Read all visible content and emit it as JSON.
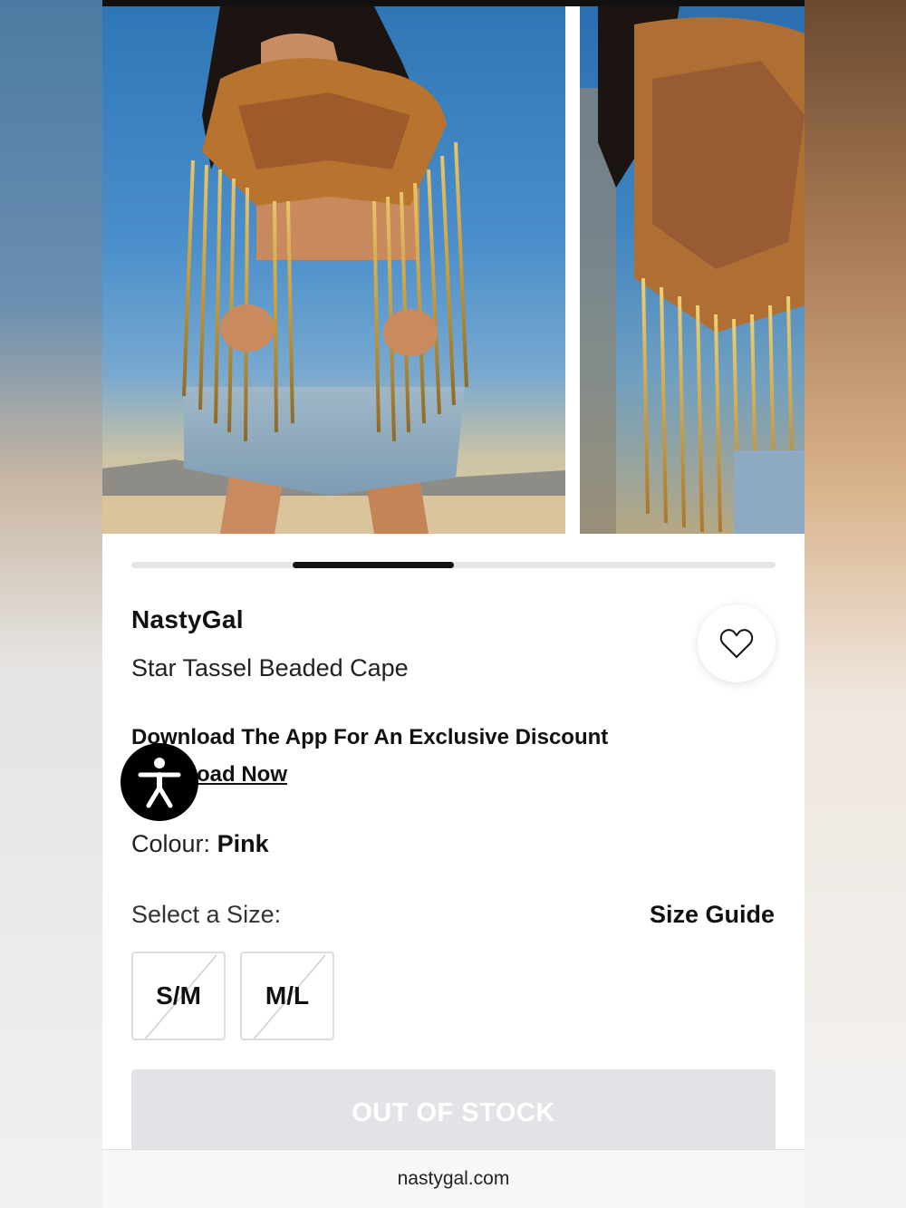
{
  "product": {
    "brand": "NastyGal",
    "name": "Star Tassel Beaded Cape",
    "colour_label": "Colour:",
    "colour_value": "Pink"
  },
  "promo": {
    "text": "Download The App For An Exclusive Discount",
    "link": "Download Now"
  },
  "sizes": {
    "label": "Select a Size:",
    "guide": "Size Guide",
    "options": [
      {
        "label": "S/M",
        "available": false
      },
      {
        "label": "M/L",
        "available": false
      }
    ]
  },
  "cta": {
    "label": "OUT OF STOCK"
  },
  "browser": {
    "url": "nastygal.com"
  },
  "gallery": {
    "images": [
      "model-front-photo",
      "model-side-detail-photo"
    ],
    "active_index": 0
  },
  "icons": {
    "wishlist": "heart-icon",
    "accessibility": "accessibility-icon"
  },
  "colors": {
    "cta_disabled_bg": "#e2e3e6",
    "text_primary": "#111111",
    "scroll_thumb": "#111111"
  }
}
